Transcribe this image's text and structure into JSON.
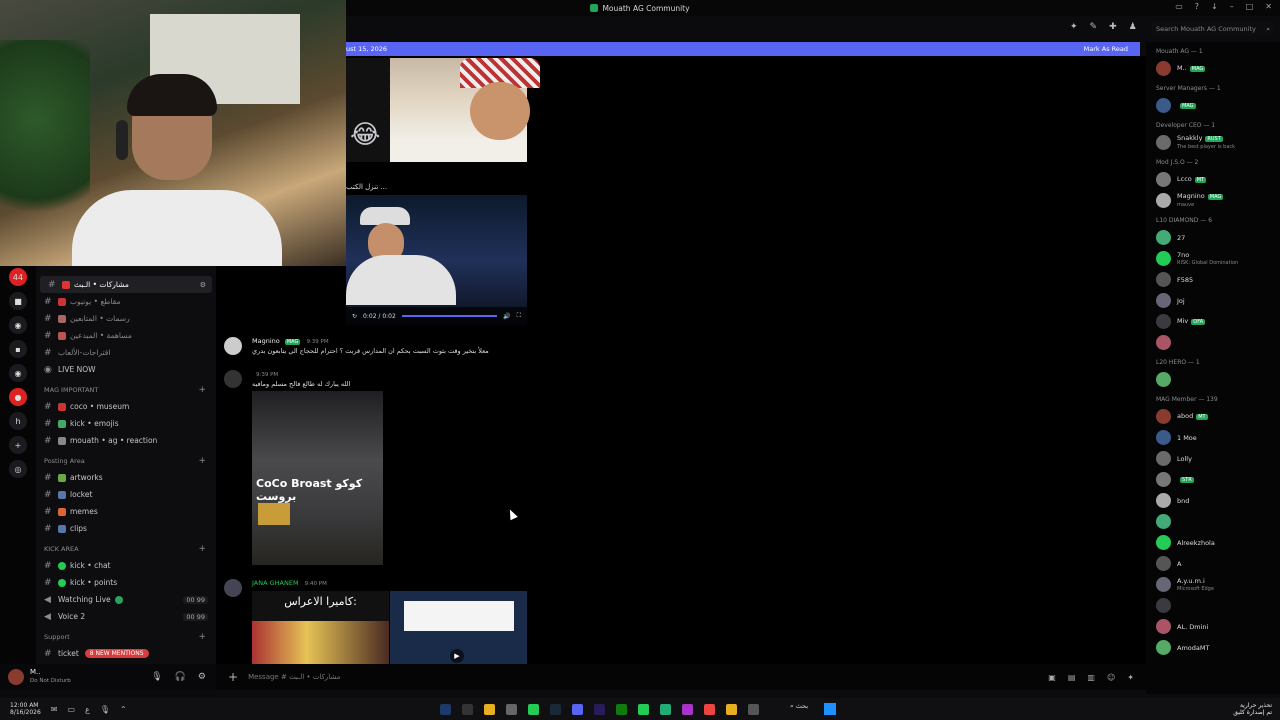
{
  "window": {
    "title": "Mouath AG Community"
  },
  "header": {
    "banner_date": "ust 15, 2026",
    "mark_as_read": "Mark As Read",
    "search_placeholder": "Search Mouath AG Community"
  },
  "sidebar": {
    "channels_top": [
      {
        "label": "مشاركات • الـبث",
        "active": true
      },
      {
        "label": "مقاطع • يوتيوب",
        "active": false
      },
      {
        "label": "رسمات • المتابعين",
        "active": false
      },
      {
        "label": "مساهمة • المبدعين",
        "active": false
      },
      {
        "label": "اقتراحات-الألعاب",
        "active": false
      }
    ],
    "live_now": "LIVE NOW",
    "categories": [
      {
        "name": "MAG IMPORTANT",
        "items": [
          "coco • museum",
          "kick • emojis",
          "mouath • ag • reaction"
        ]
      },
      {
        "name": "Posting Area",
        "items": [
          "artworks",
          "locket",
          "memes",
          "clips"
        ]
      },
      {
        "name": "KICK AREA",
        "items": [
          "kick • chat",
          "kick • points"
        ]
      }
    ],
    "voice": [
      {
        "label": "Watching Live",
        "count": "00 99"
      },
      {
        "label": "Voice 2",
        "count": "00 99"
      }
    ],
    "support": {
      "name": "Support",
      "ticket": "ticket",
      "badge": "8 NEW MENTIONS"
    }
  },
  "user": {
    "name": "M..",
    "status": "Do Not Disturb"
  },
  "messages": {
    "caption1": "تنزل الكتب ...",
    "video_time": "0:02 / 0:02",
    "video_progress": 1.0,
    "m1": {
      "author": "Magnino",
      "tag": "MAG",
      "time": "9:39 PM",
      "text": "معلأ بتخير وقت بثوت السبت بحكم ان المدارس قربت ؟ احترام للحجاج الي يتابعون بدري"
    },
    "m2": {
      "time": "9:39 PM",
      "text": "الله يبارك له طالع فالح مسلم ومافيه"
    },
    "image2_sign": "CoCo Broast كوكو بروست",
    "m3": {
      "author": "JANA GHANEM",
      "time": "9:40 PM"
    },
    "image3_text": "كاميرا الاعراس:"
  },
  "composer": {
    "placeholder": "Message # مشاركات • الـبث"
  },
  "members": {
    "groups": [
      {
        "name": "Mouath AG — 1",
        "items": [
          {
            "name": "M..",
            "tag": "MAG",
            "sub": ""
          }
        ]
      },
      {
        "name": "Server Managers — 1",
        "items": [
          {
            "name": "",
            "tag": "MAG",
            "sub": ""
          }
        ]
      },
      {
        "name": "Developer CEO — 1",
        "items": [
          {
            "name": "Snakkly",
            "tag": "RUST",
            "sub": "The best player is back"
          }
        ]
      },
      {
        "name": "Mod J.S.O — 2",
        "items": [
          {
            "name": "Lcco",
            "tag": "MT",
            "sub": ""
          },
          {
            "name": "Magnino",
            "tag": "MAG",
            "sub": "mauve"
          }
        ]
      },
      {
        "name": "L10 DIAMOND — 6",
        "items": [
          {
            "name": "27",
            "tag": "",
            "sub": ""
          },
          {
            "name": "7no",
            "tag": "",
            "sub": "RISK: Global Domination"
          },
          {
            "name": "F585",
            "tag": "",
            "sub": ""
          },
          {
            "name": "Joj",
            "tag": "",
            "sub": ""
          },
          {
            "name": "Miv",
            "tag": "OFA",
            "sub": ""
          },
          {
            "name": "",
            "tag": "",
            "sub": ""
          }
        ]
      },
      {
        "name": "L20 HERO — 1",
        "items": [
          {
            "name": "",
            "tag": "",
            "sub": ""
          }
        ]
      },
      {
        "name": "MAG Member — 139",
        "items": [
          {
            "name": "abod",
            "tag": "MT",
            "sub": ""
          },
          {
            "name": "1 Moe",
            "tag": "",
            "sub": ""
          },
          {
            "name": "Lolly",
            "tag": "",
            "sub": ""
          },
          {
            "name": "",
            "tag": "STR",
            "sub": ""
          },
          {
            "name": "bnd",
            "tag": "",
            "sub": ""
          },
          {
            "name": "",
            "tag": "",
            "sub": ""
          },
          {
            "name": "Alreekzhola",
            "tag": "",
            "sub": ""
          },
          {
            "name": "A",
            "tag": "",
            "sub": ""
          },
          {
            "name": "A.y.u.m.i",
            "tag": "",
            "sub": "Microsoft Edge"
          },
          {
            "name": "",
            "tag": "",
            "sub": ""
          },
          {
            "name": "AL. Dmini",
            "tag": "",
            "sub": ""
          },
          {
            "name": "AmodaMT",
            "tag": "",
            "sub": ""
          }
        ]
      }
    ]
  },
  "taskbar": {
    "time": "12:00 AM",
    "date": "8/16/2026",
    "search": "بحث",
    "notice_line1": "تحذير حرارية",
    "notice_line2": "تم إصدارة كليق"
  }
}
